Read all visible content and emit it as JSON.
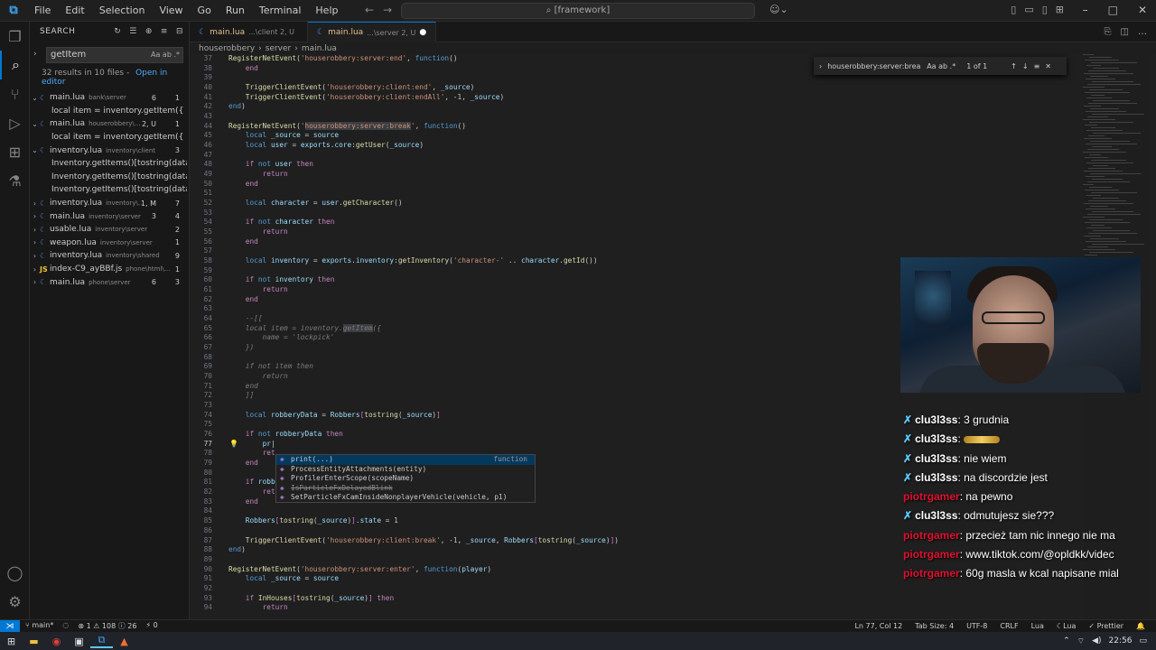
{
  "menu": [
    "File",
    "Edit",
    "Selection",
    "View",
    "Go",
    "Run",
    "Terminal",
    "Help"
  ],
  "command_center": "[framework]",
  "sidebar": {
    "title": "SEARCH",
    "query": "getItem",
    "query_opts": "Aa ab .*",
    "results_msg": "32 results in 10 files - ",
    "open_in_editor": "Open in editor",
    "rows": [
      {
        "kind": "file",
        "chev": "⌄",
        "icon": "lua",
        "name": "main.lua",
        "path": "bank\\server",
        "c1": "6",
        "c2": "1"
      },
      {
        "kind": "match",
        "text": "local item = inventory.getItem({"
      },
      {
        "kind": "file",
        "chev": "⌄",
        "icon": "lua",
        "name": "main.lua",
        "path": "houserobbery\\...",
        "c1": "2, U",
        "c2": "1"
      },
      {
        "kind": "match",
        "text": "local item = inventory.getItem({"
      },
      {
        "kind": "file",
        "chev": "⌄",
        "icon": "lua",
        "name": "inventory.lua",
        "path": "inventory\\client",
        "c1": "",
        "c2": "3"
      },
      {
        "kind": "match",
        "text": "Inventory.getItems()[tostring(data.ite..."
      },
      {
        "kind": "match",
        "text": "Inventory.getItems()[tostring(data.ite..."
      },
      {
        "kind": "match",
        "text": "Inventory.getItems()[tostring(data.slot..."
      },
      {
        "kind": "file",
        "chev": "›",
        "icon": "lua",
        "name": "inventory.lua",
        "path": "inventory\\...",
        "c1": "1, M",
        "c2": "7"
      },
      {
        "kind": "file",
        "chev": "›",
        "icon": "lua",
        "name": "main.lua",
        "path": "inventory\\server",
        "c1": "3",
        "c2": "4"
      },
      {
        "kind": "file",
        "chev": "›",
        "icon": "lua",
        "name": "usable.lua",
        "path": "inventory\\server",
        "c1": "",
        "c2": "2"
      },
      {
        "kind": "file",
        "chev": "›",
        "icon": "lua",
        "name": "weapon.lua",
        "path": "inventory\\server",
        "c1": "",
        "c2": "1"
      },
      {
        "kind": "file",
        "chev": "›",
        "icon": "lua",
        "name": "inventory.lua",
        "path": "inventory\\shared",
        "c1": "",
        "c2": "9"
      },
      {
        "kind": "file",
        "chev": "›",
        "icon": "js",
        "name": "index-C9_ayBBf.js",
        "path": "phone\\html\\...",
        "c1": "",
        "c2": "1"
      },
      {
        "kind": "file",
        "chev": "›",
        "icon": "lua",
        "name": "main.lua",
        "path": "phone\\server",
        "c1": "6",
        "c2": "3"
      }
    ]
  },
  "tabs": [
    {
      "name": "main.lua",
      "sub": "...\\client 2, U",
      "active": false,
      "dot": ""
    },
    {
      "name": "main.lua",
      "sub": "...\\server 2, U",
      "active": true,
      "dot": "●"
    }
  ],
  "breadcrumb": [
    "houserobbery",
    "server",
    "main.lua"
  ],
  "find": {
    "query": "houserobbery:server:break",
    "count": "1 of 1",
    "opts": "Aa ab .*"
  },
  "suggest": [
    {
      "icon": "◈",
      "label": "print(...)",
      "type": "function",
      "sel": true,
      "strike": false
    },
    {
      "icon": "◈",
      "label": "ProcessEntityAttachments(entity)",
      "type": "",
      "sel": false,
      "strike": false
    },
    {
      "icon": "◈",
      "label": "ProfilerEnterScope(scopeName)",
      "type": "",
      "sel": false,
      "strike": false
    },
    {
      "icon": "◈",
      "label": "IsParticleFxDelayedBlink",
      "type": "",
      "sel": false,
      "strike": true
    },
    {
      "icon": "◈",
      "label": "SetParticleFxCamInsideNonplayerVehicle(vehicle, p1)",
      "type": "",
      "sel": false,
      "strike": false
    }
  ],
  "chat": [
    {
      "user": "clu3l3ss",
      "msg": "3 grudnia",
      "color": "white",
      "badge": "✗"
    },
    {
      "user": "clu3l3ss",
      "msg": "",
      "color": "white",
      "badge": "✗"
    },
    {
      "user": "clu3l3ss",
      "msg": "nie wiem",
      "color": "white",
      "badge": "✗"
    },
    {
      "user": "clu3l3ss",
      "msg": "na discordzie jest",
      "color": "white",
      "badge": "✗"
    },
    {
      "user": "piotrgamer",
      "msg": "na pewno",
      "color": "red",
      "badge": ""
    },
    {
      "user": "clu3l3ss",
      "msg": "odmutujesz sie???",
      "color": "white",
      "badge": "✗"
    },
    {
      "user": "piotrgamer",
      "msg": "przecież tam nic innego nie ma",
      "color": "red",
      "badge": ""
    },
    {
      "user": "piotrgamer",
      "msg": "www.tiktok.com/@opldkk/videc",
      "color": "red",
      "badge": ""
    },
    {
      "user": "piotrgamer",
      "msg": "60g masla w kcal napisane mial",
      "color": "red",
      "badge": ""
    }
  ],
  "status": {
    "branch": "main*",
    "problems": "⊗ 1  ⚠ 108  ⓘ 26",
    "ports": "⚡ 0",
    "position": "Ln 77, Col 12",
    "tabsize": "Tab Size: 4",
    "encoding": "UTF-8",
    "eol": "CRLF",
    "lang": "Lua",
    "lang2": "Lua",
    "prettier": "✓ Prettier"
  },
  "clock": "22:56",
  "colors": {
    "accent": "#0078d4",
    "chat_red": "#e01030"
  }
}
